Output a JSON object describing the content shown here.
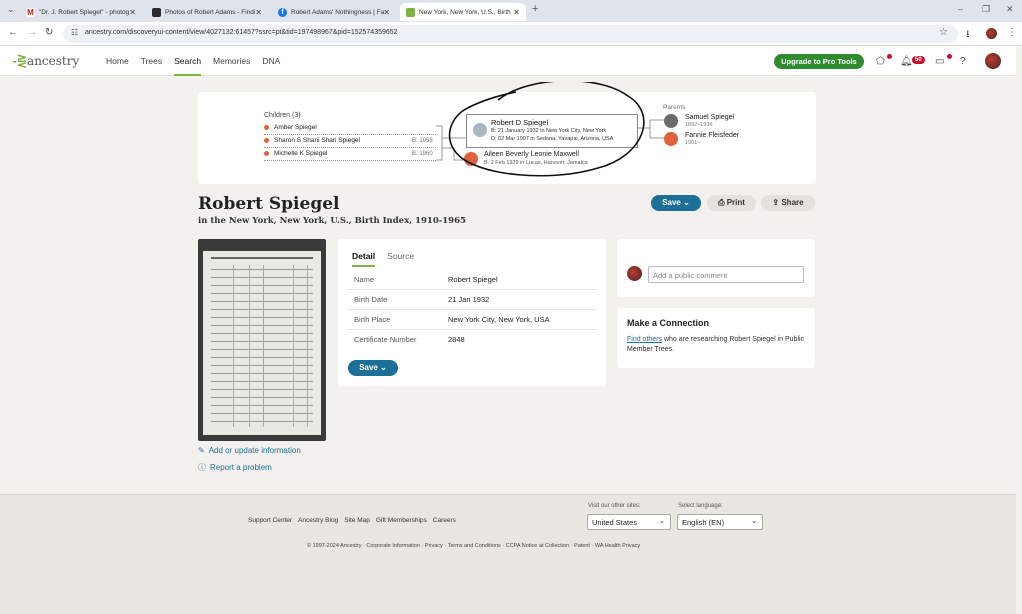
{
  "browser": {
    "tabs": [
      {
        "title": "\"Dr. J. Robert Spiegel\" - photog",
        "fav": "#c5221f",
        "glyph": "M"
      },
      {
        "title": "Photos of Robert Adams - Findi",
        "fav": "#2b2b2b",
        "glyph": ""
      },
      {
        "title": "Robert Adams' Nothingness | Fa",
        "fav": "#1877f2",
        "glyph": "f"
      },
      {
        "title": "New York, New York, U.S., Birth",
        "fav": "#7cb342",
        "glyph": ""
      }
    ],
    "url": "ancestry.com/discoveryui-content/view/4027132:61457?ssrc=pt&tid=197498967&pid=152574359652"
  },
  "header": {
    "logo": "ancestry",
    "nav": [
      "Home",
      "Trees",
      "Search",
      "Memories",
      "DNA"
    ],
    "active_nav": "Search",
    "upgrade": "Upgrade to Pro Tools",
    "notif_count": "50"
  },
  "family": {
    "children_header": "Children (3)",
    "children": [
      {
        "name": "Amber Spiegel",
        "born": ""
      },
      {
        "name": "Sharon S Sharii Shari Spiegel",
        "born": "B: 1958"
      },
      {
        "name": "Michelle K Spiegel",
        "born": "B: 1960"
      }
    ],
    "person": {
      "name": "Robert D Spiegel",
      "birth": "B: 21 January 1932 in New York City, New York",
      "death": "D: 02 Mar 1997 in Sedona, Yavapai, Arizona, USA"
    },
    "spouse": {
      "name": "Aileen Beverly Leonie Maxwell",
      "birth": "B: 2 Feb 1929 in Lucas, Hanover, Jamaica"
    },
    "parents_header": "Parents",
    "parents": [
      {
        "name": "Samuel Spiegel",
        "years": "1892–1936",
        "color": "#6b6b6b"
      },
      {
        "name": "Fannie Fleisfeder",
        "years": "1901–",
        "color": "#e0623c"
      }
    ]
  },
  "record": {
    "title": "Robert Spiegel",
    "subtitle": "in the New York, New York, U.S., Birth Index, 1910-1965",
    "save": "Save",
    "print": "Print",
    "share": "Share",
    "links": [
      "Add or update information",
      "Report a problem"
    ]
  },
  "detail": {
    "tabs": [
      "Detail",
      "Source"
    ],
    "rows": [
      {
        "k": "Name",
        "v": "Robert Spiegel"
      },
      {
        "k": "Birth Date",
        "v": "21 Jan 1932"
      },
      {
        "k": "Birth Place",
        "v": "New York City, New York, USA"
      },
      {
        "k": "Certificate Number",
        "v": "2848"
      }
    ],
    "save": "Save"
  },
  "comment": {
    "placeholder": "Add a public comment"
  },
  "connection": {
    "title": "Make a Connection",
    "link": "Find others",
    "text": " who are researching Robert Spiegel in Public Member Trees."
  },
  "footer": {
    "links": [
      "Support Center",
      "Ancestry Blog",
      "Site Map",
      "Gift Memberships",
      "Careers"
    ],
    "sites_label": "Visit our other sites:",
    "site_value": "United States",
    "lang_label": "Select language:",
    "lang_value": "English (EN)",
    "copyright": "© 1997-2024 Ancestry · Corporate Information · Privacy · Terms and Conditions · CCPA Notice at Collection · Patent · WA Health Privacy"
  }
}
